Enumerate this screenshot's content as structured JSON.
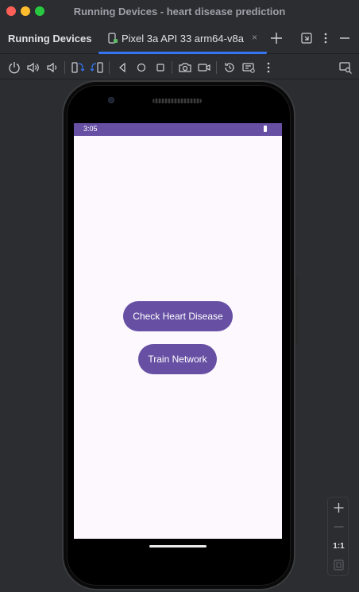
{
  "window": {
    "title": "Running Devices - heart disease prediction"
  },
  "panel": {
    "title": "Running Devices"
  },
  "tab": {
    "label": "Pixel 3a API 33 arm64-v8a",
    "close": "×"
  },
  "toolbar": {
    "icons": [
      "power-icon",
      "volume-up-icon",
      "volume-down-icon",
      "rotate-left-icon",
      "rotate-right-icon",
      "back-icon",
      "home-icon",
      "overview-icon",
      "camera-icon",
      "video-icon",
      "reset-icon",
      "snapshot-icon",
      "more-icon",
      "inspect-icon"
    ]
  },
  "device": {
    "status_time": "3:05",
    "buttons": {
      "check": "Check Heart Disease",
      "train": "Train Network"
    }
  },
  "zoom": {
    "actual_size": "1:1"
  },
  "colors": {
    "accent": "#3574f0",
    "app_primary": "#6750a4",
    "app_background": "#fdf7fe"
  }
}
